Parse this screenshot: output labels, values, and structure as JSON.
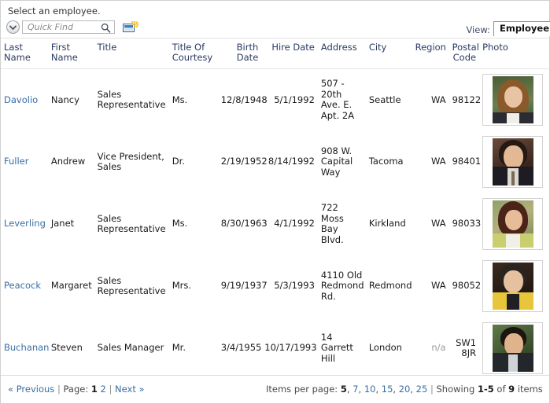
{
  "caption": "Select an employee.",
  "toolbar": {
    "chevron_icon": "chevron-down-icon",
    "quick_find_placeholder": "Quick Find",
    "quick_find_value": "",
    "search_icon": "magnifier-icon",
    "new_record_icon": "new-record-icon",
    "view_label": "View:",
    "view_selected": "Employee"
  },
  "grid": {
    "columns": [
      {
        "label": "Last Name",
        "align": "left"
      },
      {
        "label": "First Name",
        "align": "left"
      },
      {
        "label": "Title",
        "align": "left"
      },
      {
        "label": "Title Of Courtesy",
        "align": "left"
      },
      {
        "label": "Birth Date",
        "align": "right"
      },
      {
        "label": "Hire Date",
        "align": "right"
      },
      {
        "label": "Address",
        "align": "left"
      },
      {
        "label": "City",
        "align": "left"
      },
      {
        "label": "Region",
        "align": "right"
      },
      {
        "label": "Postal Code",
        "align": "right"
      },
      {
        "label": "Photo",
        "align": "left"
      }
    ],
    "rows": [
      {
        "last_name": "Davolio",
        "first_name": "Nancy",
        "title": "Sales Representative",
        "title_of_courtesy": "Ms.",
        "birth_date": "12/8/1948",
        "hire_date": "5/1/1992",
        "address": "507 - 20th Ave. E. Apt. 2A",
        "city": "Seattle",
        "region": "WA",
        "postal_code": "98122",
        "photo": "employee-photo"
      },
      {
        "last_name": "Fuller",
        "first_name": "Andrew",
        "title": "Vice President, Sales",
        "title_of_courtesy": "Dr.",
        "birth_date": "2/19/1952",
        "hire_date": "8/14/1992",
        "address": "908 W. Capital Way",
        "city": "Tacoma",
        "region": "WA",
        "postal_code": "98401",
        "photo": "employee-photo"
      },
      {
        "last_name": "Leverling",
        "first_name": "Janet",
        "title": "Sales Representative",
        "title_of_courtesy": "Ms.",
        "birth_date": "8/30/1963",
        "hire_date": "4/1/1992",
        "address": "722 Moss Bay Blvd.",
        "city": "Kirkland",
        "region": "WA",
        "postal_code": "98033",
        "photo": "employee-photo"
      },
      {
        "last_name": "Peacock",
        "first_name": "Margaret",
        "title": "Sales Representative",
        "title_of_courtesy": "Mrs.",
        "birth_date": "9/19/1937",
        "hire_date": "5/3/1993",
        "address": "4110 Old Redmond Rd.",
        "city": "Redmond",
        "region": "WA",
        "postal_code": "98052",
        "photo": "employee-photo"
      },
      {
        "last_name": "Buchanan",
        "first_name": "Steven",
        "title": "Sales Manager",
        "title_of_courtesy": "Mr.",
        "birth_date": "3/4/1955",
        "hire_date": "10/17/1993",
        "address": "14 Garrett Hill",
        "city": "London",
        "region": "n/a",
        "postal_code": "SW1 8JR",
        "photo": "employee-photo"
      }
    ]
  },
  "footer": {
    "previous": "« Previous",
    "sep1": " | ",
    "page_label": "Page: ",
    "page_current": "1",
    "page_other": "2",
    "sep2": " | ",
    "next": "Next »",
    "items_per_page_label": "Items per page: ",
    "ipp_selected": "5",
    "ipp_options": [
      ", ",
      "7",
      ", ",
      "10",
      ", ",
      "15",
      ", ",
      "20",
      ", ",
      "25"
    ],
    "ipp_7": "7",
    "ipp_10": "10",
    "ipp_15": "15",
    "ipp_20": "20",
    "ipp_25": "25",
    "sep3": " | ",
    "showing_label": "Showing ",
    "showing_range": "1-5",
    "showing_of": " of ",
    "showing_total": "9",
    "showing_items": " items"
  },
  "colors": {
    "link": "#3a6ea5",
    "header_text": "#2b3a63",
    "muted": "#9a9a9a",
    "border": "#cfcfcf"
  }
}
